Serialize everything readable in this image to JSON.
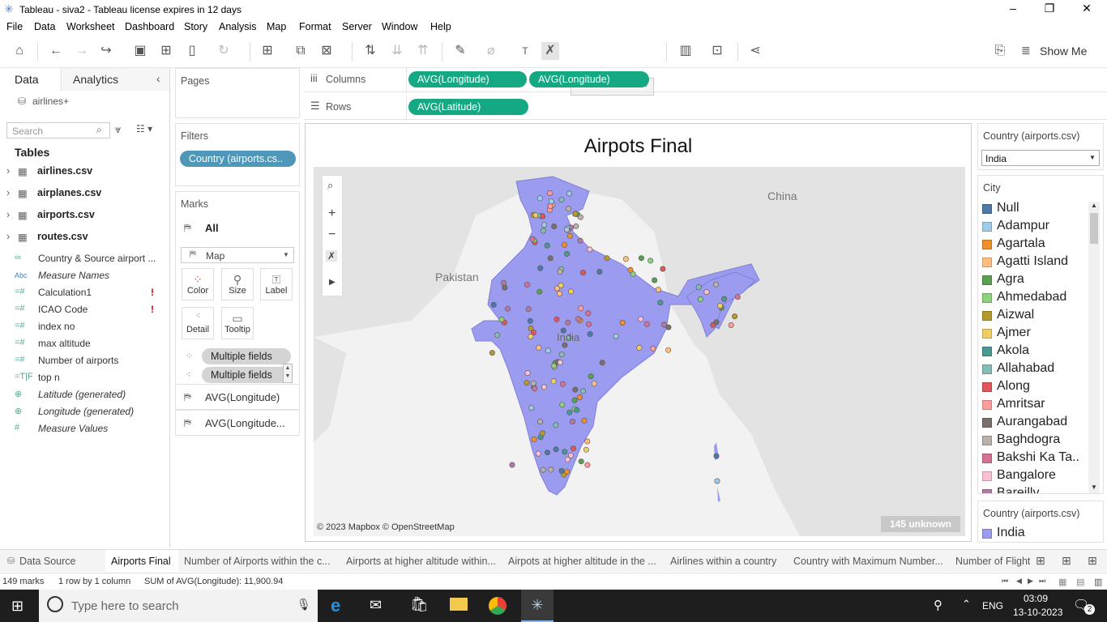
{
  "window": {
    "title": "Tableau - siva2 - Tableau license expires in 12 days"
  },
  "menu": [
    "File",
    "Data",
    "Worksheet",
    "Dashboard",
    "Story",
    "Analysis",
    "Map",
    "Format",
    "Server",
    "Window",
    "Help"
  ],
  "toolbar": {
    "show_me": "Show Me"
  },
  "data_pane": {
    "tabs": {
      "data": "Data",
      "analytics": "Analytics"
    },
    "datasource": "airlines+",
    "search_placeholder": "Search",
    "tables_heading": "Tables",
    "tables": [
      "airlines.csv",
      "airplanes.csv",
      "airports.csv",
      "routes.csv"
    ],
    "fields": [
      {
        "icon": "link-icon",
        "glyph": "∞",
        "name": "Country & Source airport ...",
        "italic": false,
        "warn": false
      },
      {
        "icon": "abc-icon",
        "glyph": "Abc",
        "name": "Measure Names",
        "italic": true,
        "warn": false
      },
      {
        "icon": "calc-measure-icon",
        "glyph": "=#",
        "name": "Calculation1",
        "italic": false,
        "warn": true
      },
      {
        "icon": "calc-measure-icon",
        "glyph": "=#",
        "name": "ICAO Code",
        "italic": false,
        "warn": true
      },
      {
        "icon": "calc-measure-icon",
        "glyph": "=#",
        "name": "index no",
        "italic": false,
        "warn": false
      },
      {
        "icon": "calc-measure-icon",
        "glyph": "=#",
        "name": "max altitude",
        "italic": false,
        "warn": false
      },
      {
        "icon": "calc-measure-icon",
        "glyph": "=#",
        "name": "Number of airports",
        "italic": false,
        "warn": false
      },
      {
        "icon": "calc-tf-icon",
        "glyph": "=T|F",
        "name": "top n",
        "italic": false,
        "warn": false
      },
      {
        "icon": "globe-icon",
        "glyph": "⊕",
        "name": "Latitude (generated)",
        "italic": true,
        "warn": false
      },
      {
        "icon": "globe-icon",
        "glyph": "⊕",
        "name": "Longitude (generated)",
        "italic": true,
        "warn": false
      },
      {
        "icon": "measure-icon",
        "glyph": "#",
        "name": "Measure Values",
        "italic": true,
        "warn": false
      }
    ]
  },
  "pages": {
    "label": "Pages"
  },
  "filters": {
    "label": "Filters",
    "pill": "Country (airports.cs.."
  },
  "marks": {
    "label": "Marks",
    "all": "All",
    "type": "Map",
    "buttons": {
      "color": "Color",
      "size": "Size",
      "label": "Label",
      "detail": "Detail",
      "tooltip": "Tooltip"
    },
    "fields": [
      "Multiple fields",
      "Multiple fields"
    ],
    "layers": [
      "AVG(Longitude)",
      "AVG(Longitude..."
    ]
  },
  "shelves": {
    "columns_label": "Columns",
    "columns": [
      "AVG(Longitude)",
      "AVG(Longitude)"
    ],
    "rows_label": "Rows",
    "rows": [
      "AVG(Latitude)"
    ]
  },
  "view": {
    "title": "Airpots Final",
    "map_labels": {
      "china": "China",
      "pakistan": "Pakistan",
      "india": "India"
    },
    "attribution": "© 2023 Mapbox © OpenStreetMap",
    "unknown": "145 unknown"
  },
  "right_pane": {
    "country_filter_title": "Country (airports.csv)",
    "country_filter_value": "India",
    "city_legend_title": "City",
    "cities": [
      {
        "name": "Null",
        "color": "#4e79a7"
      },
      {
        "name": "Adampur",
        "color": "#a0cbe8"
      },
      {
        "name": "Agartala",
        "color": "#f28e2b"
      },
      {
        "name": "Agatti Island",
        "color": "#ffbe7d"
      },
      {
        "name": "Agra",
        "color": "#59a14f"
      },
      {
        "name": "Ahmedabad",
        "color": "#8cd17d"
      },
      {
        "name": "Aizwal",
        "color": "#b6992d"
      },
      {
        "name": "Ajmer",
        "color": "#f1ce63"
      },
      {
        "name": "Akola",
        "color": "#499894"
      },
      {
        "name": "Allahabad",
        "color": "#86bcb6"
      },
      {
        "name": "Along",
        "color": "#e15759"
      },
      {
        "name": "Amritsar",
        "color": "#ff9d9a"
      },
      {
        "name": "Aurangabad",
        "color": "#79706e"
      },
      {
        "name": "Baghdogra",
        "color": "#bab0ac"
      },
      {
        "name": "Bakshi Ka Ta..",
        "color": "#d37295"
      },
      {
        "name": "Bangalore",
        "color": "#fabfd2"
      },
      {
        "name": "Bareilly",
        "color": "#b07aa1"
      }
    ],
    "country_legend_title": "Country (airports.csv)",
    "country_legend": [
      {
        "name": "India",
        "color": "#9b9bef"
      }
    ]
  },
  "sheet_tabs": {
    "data_source": "Data Source",
    "tabs": [
      "Airports Final",
      "Number of Airports within the c...",
      "Airports at higher altitude within...",
      "Airpots at higher altitude in the ...",
      "Airlines within a country",
      "Country with Maximum Number...",
      "Number of Flight"
    ]
  },
  "status": {
    "marks": "149 marks",
    "dims": "1 row by 1 column",
    "sum": "SUM of AVG(Longitude): 11,900.94"
  },
  "taskbar": {
    "search_placeholder": "Type here to search",
    "lang": "ENG",
    "time": "03:09",
    "date": "13-10-2023",
    "notifications": "2"
  }
}
